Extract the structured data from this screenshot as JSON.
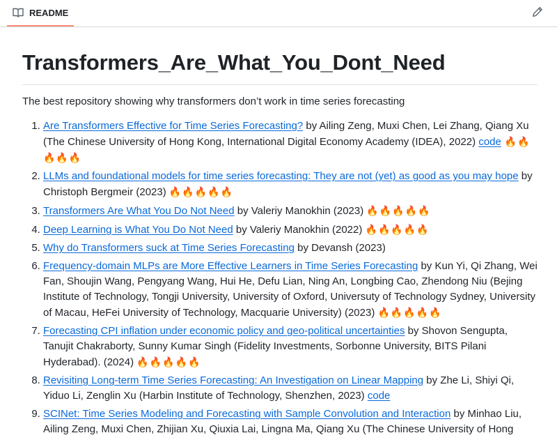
{
  "tab": {
    "label": "README"
  },
  "title": "Transformers_Are_What_You_Dont_Need",
  "description": "The best repository showing why transformers don’t work in time series forecasting",
  "items": [
    {
      "link": "Are Transformers Effective for Time Series Forecasting?",
      "text": " by Ailing Zeng, Muxi Chen, Lei Zhang, Qiang Xu (The Chinese University of Hong Kong, International Digital Economy Academy (IDEA), 2022) ",
      "code": "code",
      "fire": " 🔥🔥🔥🔥🔥"
    },
    {
      "link": "LLMs and foundational models for time series forecasting: They are not (yet) as good as you may hope",
      "text": " by Christoph Bergmeir (2023) ",
      "code": "",
      "fire": "🔥🔥🔥🔥🔥"
    },
    {
      "link": "Transformers Are What You Do Not Need",
      "text": " by Valeriy Manokhin (2023) ",
      "code": "",
      "fire": "🔥🔥🔥🔥🔥"
    },
    {
      "link": "Deep Learning is What You Do Not Need",
      "text": " by Valeriy Manokhin (2022) ",
      "code": "",
      "fire": "🔥🔥🔥🔥🔥"
    },
    {
      "link": "Why do Transformers suck at Time Series Forecasting",
      "text": " by Devansh (2023)",
      "code": "",
      "fire": ""
    },
    {
      "link": "Frequency-domain MLPs are More Effective Learners in Time Series Forecasting",
      "text": " by Kun Yi, Qi Zhang, Wei Fan, Shoujin Wang, Pengyang Wang, Hui He, Defu Lian, Ning An, Longbing Cao, Zhendong Niu (Bejing Institute of Technology, Tongji University, University of Oxford, Universuty of Technology Sydney, University of Macau, HeFei University of Technology, Macquarie University) (2023) ",
      "code": "",
      "fire": "🔥🔥🔥🔥🔥"
    },
    {
      "link": "Forecasting CPI inflation under economic policy and geo-political uncertainties",
      "text": " by Shovon Sengupta, Tanujit Chakraborty, Sunny Kumar Singh (Fidelity Investments, Sorbonne University, BITS Pilani Hyderabad). (2024) ",
      "code": "",
      "fire": "🔥🔥🔥🔥🔥"
    },
    {
      "link": "Revisiting Long-term Time Series Forecasting: An Investigation on Linear Mapping",
      "text": " by Zhe Li, Shiyi Qi, Yiduo Li, Zenglin Xu (Harbin Institute of Technology, Shenzhen, 2023) ",
      "code": "code",
      "fire": ""
    },
    {
      "link": "SCINet: Time Series Modeling and Forecasting with Sample Convolution and Interaction",
      "text": " by Minhao Liu, Ailing Zeng, Muxi Chen, Zhijian Xu, Qiuxia Lai, Lingna Ma, Qiang Xu (The Chinese University of Hong",
      "code": "",
      "fire": ""
    }
  ],
  "icons": {
    "readme": "book-icon",
    "edit": "pencil-icon"
  },
  "colors": {
    "link": "#0969da",
    "tab_underline": "#fd8c73"
  }
}
